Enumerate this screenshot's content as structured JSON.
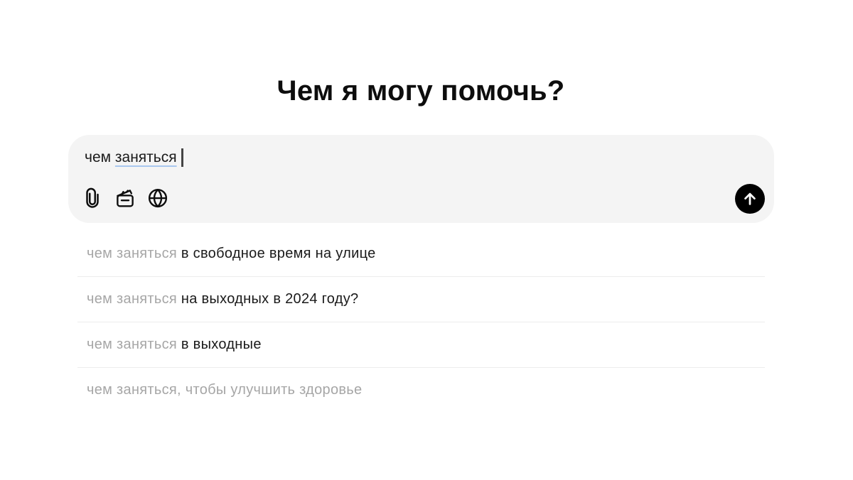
{
  "heading": "Чем я могу помочь?",
  "composer": {
    "input_word1": "чем ",
    "input_word2": "заняться",
    "attach_icon": "paperclip-icon",
    "tools_icon": "clapperboard-icon",
    "search_icon": "globe-icon",
    "send_icon": "arrow-up-icon"
  },
  "suggestions": [
    {
      "prefix": "чем заняться",
      "rest": " в свободное время на улице"
    },
    {
      "prefix": "чем заняться",
      "rest": " на выходных в 2024 году?"
    },
    {
      "prefix": "чем заняться",
      "rest": " в выходные"
    },
    {
      "prefix": "",
      "rest": "чем заняться, чтобы улучшить здоровье"
    }
  ],
  "colors": {
    "composer_bg": "#f4f4f4",
    "send_bg": "#000000",
    "muted_text": "#a6a6a6",
    "primary_text": "#1a1a1a"
  }
}
